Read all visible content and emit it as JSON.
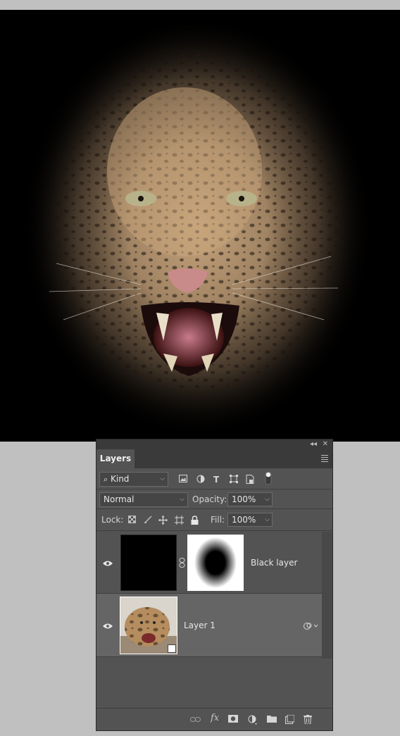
{
  "panel": {
    "tab_label": "Layers",
    "collapse_glyph": "◂◂",
    "close_glyph": "✕",
    "filter": {
      "kind_label": "Kind",
      "icons": [
        "image-filter-icon",
        "adjustment-filter-icon",
        "type-filter-icon",
        "shape-filter-icon",
        "smart-object-filter-icon",
        "filter-toggle-icon"
      ]
    },
    "blend": {
      "mode": "Normal",
      "opacity_label": "Opacity:",
      "opacity_value": "100%"
    },
    "lock": {
      "label": "Lock:",
      "fill_label": "Fill:",
      "fill_value": "100%"
    },
    "layers": [
      {
        "name": "Black layer",
        "visible": true,
        "has_mask": true,
        "selected": false
      },
      {
        "name": "Layer 1",
        "visible": true,
        "has_mask": false,
        "selected": true
      }
    ],
    "bottom_icons": [
      "link-layers-icon",
      "fx-icon",
      "add-mask-icon",
      "new-adjustment-icon",
      "new-group-icon",
      "new-layer-icon",
      "delete-icon"
    ],
    "fx_label": "fx"
  },
  "colors": {
    "panel_bg": "#535353",
    "panel_dark": "#3a3a3a",
    "selected_layer": "#656565",
    "canvas_bg": "#000000",
    "app_bg": "#c0c0c0"
  }
}
